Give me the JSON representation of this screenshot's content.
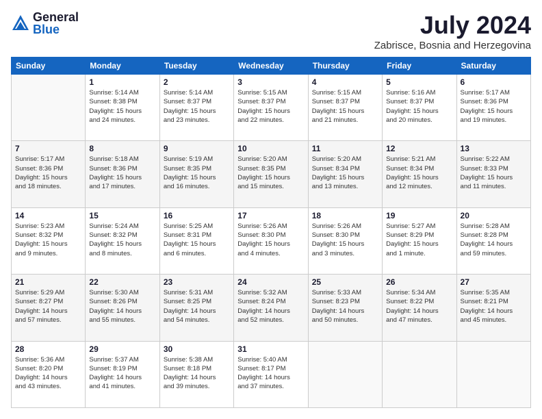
{
  "logo": {
    "general": "General",
    "blue": "Blue"
  },
  "header": {
    "month": "July 2024",
    "location": "Zabrisce, Bosnia and Herzegovina"
  },
  "weekdays": [
    "Sunday",
    "Monday",
    "Tuesday",
    "Wednesday",
    "Thursday",
    "Friday",
    "Saturday"
  ],
  "weeks": [
    [
      {
        "day": "",
        "info": ""
      },
      {
        "day": "1",
        "info": "Sunrise: 5:14 AM\nSunset: 8:38 PM\nDaylight: 15 hours\nand 24 minutes."
      },
      {
        "day": "2",
        "info": "Sunrise: 5:14 AM\nSunset: 8:37 PM\nDaylight: 15 hours\nand 23 minutes."
      },
      {
        "day": "3",
        "info": "Sunrise: 5:15 AM\nSunset: 8:37 PM\nDaylight: 15 hours\nand 22 minutes."
      },
      {
        "day": "4",
        "info": "Sunrise: 5:15 AM\nSunset: 8:37 PM\nDaylight: 15 hours\nand 21 minutes."
      },
      {
        "day": "5",
        "info": "Sunrise: 5:16 AM\nSunset: 8:37 PM\nDaylight: 15 hours\nand 20 minutes."
      },
      {
        "day": "6",
        "info": "Sunrise: 5:17 AM\nSunset: 8:36 PM\nDaylight: 15 hours\nand 19 minutes."
      }
    ],
    [
      {
        "day": "7",
        "info": "Sunrise: 5:17 AM\nSunset: 8:36 PM\nDaylight: 15 hours\nand 18 minutes."
      },
      {
        "day": "8",
        "info": "Sunrise: 5:18 AM\nSunset: 8:36 PM\nDaylight: 15 hours\nand 17 minutes."
      },
      {
        "day": "9",
        "info": "Sunrise: 5:19 AM\nSunset: 8:35 PM\nDaylight: 15 hours\nand 16 minutes."
      },
      {
        "day": "10",
        "info": "Sunrise: 5:20 AM\nSunset: 8:35 PM\nDaylight: 15 hours\nand 15 minutes."
      },
      {
        "day": "11",
        "info": "Sunrise: 5:20 AM\nSunset: 8:34 PM\nDaylight: 15 hours\nand 13 minutes."
      },
      {
        "day": "12",
        "info": "Sunrise: 5:21 AM\nSunset: 8:34 PM\nDaylight: 15 hours\nand 12 minutes."
      },
      {
        "day": "13",
        "info": "Sunrise: 5:22 AM\nSunset: 8:33 PM\nDaylight: 15 hours\nand 11 minutes."
      }
    ],
    [
      {
        "day": "14",
        "info": "Sunrise: 5:23 AM\nSunset: 8:32 PM\nDaylight: 15 hours\nand 9 minutes."
      },
      {
        "day": "15",
        "info": "Sunrise: 5:24 AM\nSunset: 8:32 PM\nDaylight: 15 hours\nand 8 minutes."
      },
      {
        "day": "16",
        "info": "Sunrise: 5:25 AM\nSunset: 8:31 PM\nDaylight: 15 hours\nand 6 minutes."
      },
      {
        "day": "17",
        "info": "Sunrise: 5:26 AM\nSunset: 8:30 PM\nDaylight: 15 hours\nand 4 minutes."
      },
      {
        "day": "18",
        "info": "Sunrise: 5:26 AM\nSunset: 8:30 PM\nDaylight: 15 hours\nand 3 minutes."
      },
      {
        "day": "19",
        "info": "Sunrise: 5:27 AM\nSunset: 8:29 PM\nDaylight: 15 hours\nand 1 minute."
      },
      {
        "day": "20",
        "info": "Sunrise: 5:28 AM\nSunset: 8:28 PM\nDaylight: 14 hours\nand 59 minutes."
      }
    ],
    [
      {
        "day": "21",
        "info": "Sunrise: 5:29 AM\nSunset: 8:27 PM\nDaylight: 14 hours\nand 57 minutes."
      },
      {
        "day": "22",
        "info": "Sunrise: 5:30 AM\nSunset: 8:26 PM\nDaylight: 14 hours\nand 55 minutes."
      },
      {
        "day": "23",
        "info": "Sunrise: 5:31 AM\nSunset: 8:25 PM\nDaylight: 14 hours\nand 54 minutes."
      },
      {
        "day": "24",
        "info": "Sunrise: 5:32 AM\nSunset: 8:24 PM\nDaylight: 14 hours\nand 52 minutes."
      },
      {
        "day": "25",
        "info": "Sunrise: 5:33 AM\nSunset: 8:23 PM\nDaylight: 14 hours\nand 50 minutes."
      },
      {
        "day": "26",
        "info": "Sunrise: 5:34 AM\nSunset: 8:22 PM\nDaylight: 14 hours\nand 47 minutes."
      },
      {
        "day": "27",
        "info": "Sunrise: 5:35 AM\nSunset: 8:21 PM\nDaylight: 14 hours\nand 45 minutes."
      }
    ],
    [
      {
        "day": "28",
        "info": "Sunrise: 5:36 AM\nSunset: 8:20 PM\nDaylight: 14 hours\nand 43 minutes."
      },
      {
        "day": "29",
        "info": "Sunrise: 5:37 AM\nSunset: 8:19 PM\nDaylight: 14 hours\nand 41 minutes."
      },
      {
        "day": "30",
        "info": "Sunrise: 5:38 AM\nSunset: 8:18 PM\nDaylight: 14 hours\nand 39 minutes."
      },
      {
        "day": "31",
        "info": "Sunrise: 5:40 AM\nSunset: 8:17 PM\nDaylight: 14 hours\nand 37 minutes."
      },
      {
        "day": "",
        "info": ""
      },
      {
        "day": "",
        "info": ""
      },
      {
        "day": "",
        "info": ""
      }
    ]
  ]
}
